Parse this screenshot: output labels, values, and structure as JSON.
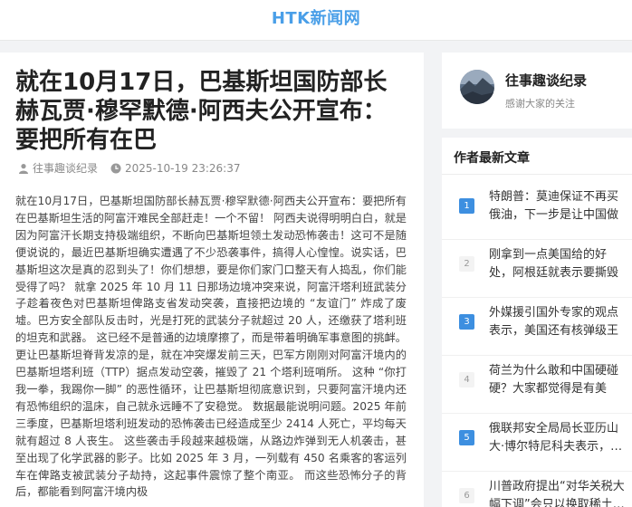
{
  "site": {
    "logo": "HTK新闻网"
  },
  "article": {
    "title": "就在10月17日，巴基斯坦国防部长赫瓦贾·穆罕默德·阿西夫公开宣布：要把所有在巴",
    "author": "往事趣谈纪录",
    "date": "2025-10-19 23:26:37",
    "body": "就在10月17日，巴基斯坦国防部长赫瓦贾·穆罕默德·阿西夫公开宣布：要把所有在巴基斯坦生活的阿富汗难民全部赶走！一个不留！ 阿西夫说得明明白白，就是因为阿富汗长期支持极端组织，不断向巴基斯坦领土发动恐怖袭击！这可不是随便说说的，最近巴基斯坦确实遭遇了不少恐袭事件，搞得人心惶惶。说实话，巴基斯坦这次是真的忍到头了！你们想想，要是你们家门口整天有人捣乱，你们能受得了吗？ 就拿 2025 年 10 月 11 日那场边境冲突来说，阿富汗塔利班武装分子趁着夜色对巴基斯坦俾路支省发动突袭，直接把边境的 “友谊门” 炸成了废墟。巴方安全部队反击时，光是打死的武装分子就超过 20 人，还缴获了塔利班的坦克和武器。 这已经不是普通的边境摩擦了，而是带着明确军事意图的挑衅。更让巴基斯坦脊背发凉的是，就在冲突爆发前三天，巴军方刚刚对阿富汗境内的巴基斯坦塔利班（TTP）据点发动空袭，摧毁了 21 个塔利班哨所。 这种 “你打我一拳，我踢你一脚” 的恶性循环，让巴基斯坦彻底意识到，只要阿富汗境内还有恐怖组织的温床，自己就永远睡不了安稳觉。 数据最能说明问题。2025 年前三季度，巴基斯坦塔利班发动的恐怖袭击已经造成至少 2414 人死亡，平均每天就有超过 8 人丧生。 这些袭击手段越来越极端，从路边炸弹到无人机袭击，甚至出现了化学武器的影子。比如 2025 年 3 月，一列载有 450 名乘客的客运列车在俾路支被武装分子劫持，这起事件震惊了整个南亚。 而这些恐怖分子的背后，都能看到阿富汗境内极"
  },
  "profile": {
    "name": "往事趣谈纪录",
    "subtitle": "感谢大家的关注"
  },
  "sidebar": {
    "heading": "作者最新文章",
    "items": [
      {
        "num": "1",
        "text": "特朗普：莫迪保证不再买俄油，下一步是让中国做到…"
      },
      {
        "num": "2",
        "text": "刚拿到一点美国给的好处，阿根廷就表示要撕毁与我…"
      },
      {
        "num": "3",
        "text": "外媒援引国外专家的观点表示，美国还有核弹级王牌…"
      },
      {
        "num": "4",
        "text": "荷兰为什么敢和中国硬碰硬？大家都觉得是有美国…"
      },
      {
        "num": "5",
        "text": "俄联邦安全局局长亚历山大·博尔特尼科夫表示，…"
      },
      {
        "num": "6",
        "text": "川普政府提出“对华关税大幅下调”会只以换取稀土…"
      }
    ]
  },
  "colors": {
    "accent": "#4a9fe8",
    "badge_hot": "#3d8fe0",
    "background": "#f2f3f5"
  },
  "icons": {
    "author": "person-icon",
    "date": "clock-icon"
  }
}
